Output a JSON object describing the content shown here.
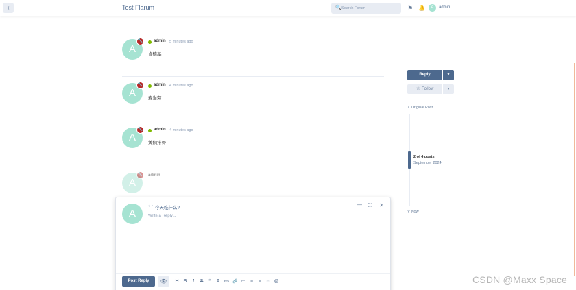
{
  "header": {
    "back_icon": "chevron-left-icon",
    "site_title": "Test Flarum",
    "search_placeholder": "Search Forum",
    "user_initial": "A",
    "username": "admin"
  },
  "posts": [
    {
      "initial": "A",
      "user": "admin",
      "time": "5 minutes ago",
      "body": "肯德基",
      "online": true
    },
    {
      "initial": "A",
      "user": "admin",
      "time": "4 minutes ago",
      "body": "麦当劳",
      "online": true
    },
    {
      "initial": "A",
      "user": "admin",
      "time": "4 minutes ago",
      "body": "黄焖排骨",
      "online": true
    },
    {
      "initial": "A",
      "user": "admin",
      "time": "",
      "body": "",
      "online": false
    }
  ],
  "sidebar": {
    "reply_label": "Reply",
    "follow_label": "Follow",
    "original_post_label": "Original Post",
    "position_label": "2 of 4 posts",
    "date_label": "September 2024",
    "now_label": "Now",
    "progress_fraction": 0.5
  },
  "composer": {
    "initial": "A",
    "title": "今天吃什么?",
    "placeholder": "Write a Reply...",
    "post_reply_label": "Post Reply",
    "tools": [
      "H",
      "B",
      "I",
      "S",
      "❝",
      "A",
      "</>",
      "🔗",
      "▭",
      "≡",
      "≡",
      "☺",
      "@"
    ]
  },
  "watermark": "CSDN @Maxx Space",
  "colors": {
    "primary": "#4d698e",
    "avatar": "#a6e3d2",
    "mod_badge": "#b72a2a",
    "online": "#7fba00"
  }
}
